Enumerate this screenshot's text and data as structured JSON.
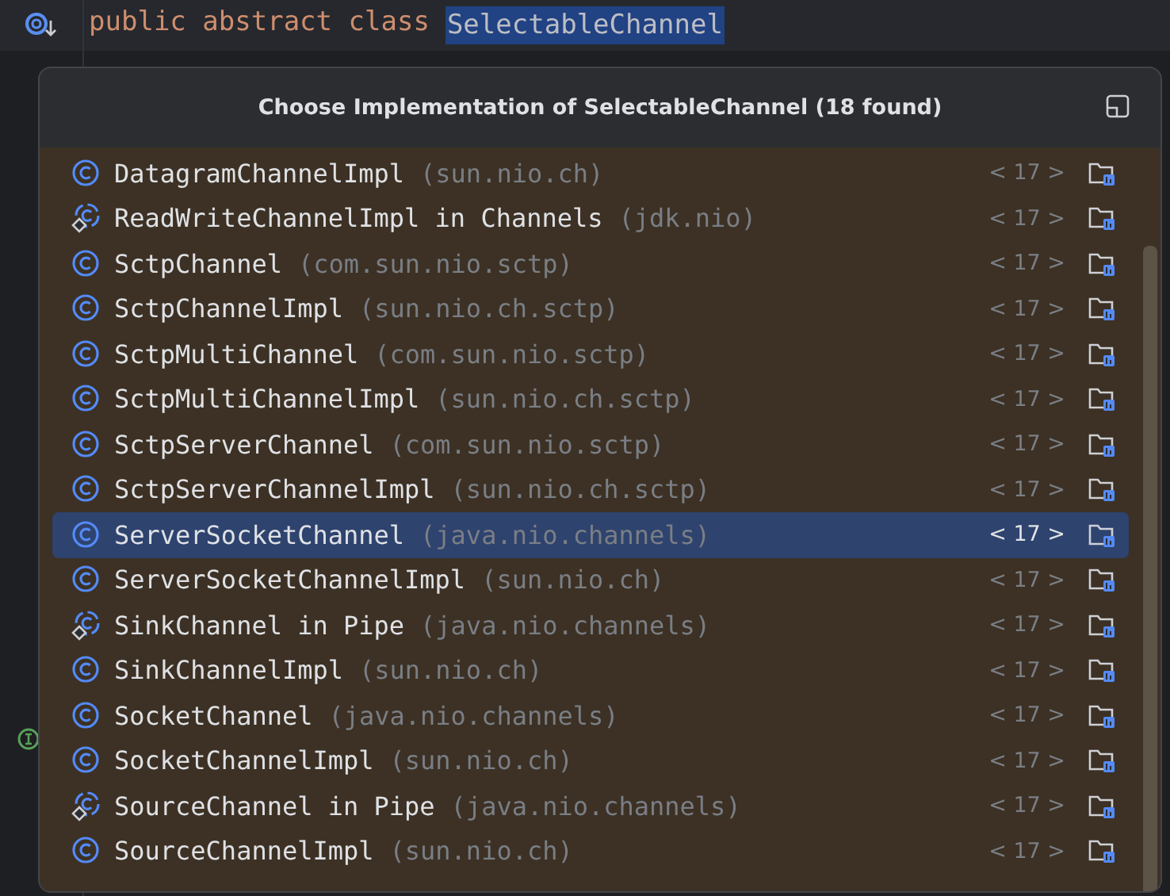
{
  "editor": {
    "code_line": [
      {
        "kind": "keyword",
        "text": "public abstract class"
      },
      {
        "kind": "name",
        "text": "SelectableChannel"
      }
    ]
  },
  "popup": {
    "title": "Choose Implementation of SelectableChannel (18 found)",
    "items": [
      {
        "kind": "class",
        "name": "DatagramChannelImpl",
        "package": "(sun.nio.ch)",
        "version": "< 17 >",
        "selected": false
      },
      {
        "kind": "nested",
        "name": "ReadWriteChannelImpl in Channels",
        "package": "(jdk.nio)",
        "version": "< 17 >",
        "selected": false
      },
      {
        "kind": "class",
        "name": "SctpChannel",
        "package": "(com.sun.nio.sctp)",
        "version": "< 17 >",
        "selected": false
      },
      {
        "kind": "class",
        "name": "SctpChannelImpl",
        "package": "(sun.nio.ch.sctp)",
        "version": "< 17 >",
        "selected": false
      },
      {
        "kind": "class",
        "name": "SctpMultiChannel",
        "package": "(com.sun.nio.sctp)",
        "version": "< 17 >",
        "selected": false
      },
      {
        "kind": "class",
        "name": "SctpMultiChannelImpl",
        "package": "(sun.nio.ch.sctp)",
        "version": "< 17 >",
        "selected": false
      },
      {
        "kind": "class",
        "name": "SctpServerChannel",
        "package": "(com.sun.nio.sctp)",
        "version": "< 17 >",
        "selected": false
      },
      {
        "kind": "class",
        "name": "SctpServerChannelImpl",
        "package": "(sun.nio.ch.sctp)",
        "version": "< 17 >",
        "selected": false
      },
      {
        "kind": "class",
        "name": "ServerSocketChannel",
        "package": "(java.nio.channels)",
        "version": "< 17 >",
        "selected": true
      },
      {
        "kind": "class",
        "name": "ServerSocketChannelImpl",
        "package": "(sun.nio.ch)",
        "version": "< 17 >",
        "selected": false
      },
      {
        "kind": "nested",
        "name": "SinkChannel in Pipe",
        "package": "(java.nio.channels)",
        "version": "< 17 >",
        "selected": false
      },
      {
        "kind": "class",
        "name": "SinkChannelImpl",
        "package": "(sun.nio.ch)",
        "version": "< 17 >",
        "selected": false
      },
      {
        "kind": "class",
        "name": "SocketChannel",
        "package": "(java.nio.channels)",
        "version": "< 17 >",
        "selected": false
      },
      {
        "kind": "class",
        "name": "SocketChannelImpl",
        "package": "(sun.nio.ch)",
        "version": "< 17 >",
        "selected": false
      },
      {
        "kind": "nested",
        "name": "SourceChannel in Pipe",
        "package": "(java.nio.channels)",
        "version": "< 17 >",
        "selected": false
      },
      {
        "kind": "class",
        "name": "SourceChannelImpl",
        "package": "(sun.nio.ch)",
        "version": "< 17 >",
        "selected": false
      }
    ]
  }
}
